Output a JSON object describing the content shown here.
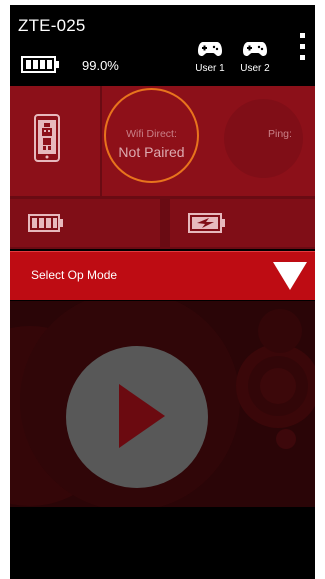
{
  "header": {
    "device_name": "ZTE-025",
    "battery_percent": "99.0%",
    "users": [
      {
        "label": "User 1",
        "icon": "gamepad-icon"
      },
      {
        "label": "User 2",
        "icon": "gamepad-icon"
      }
    ],
    "menu_icon": "overflow-menu-icon"
  },
  "status": {
    "robot_icon": "robot-controller-icon",
    "wifi_title": "Wifi Direct:",
    "wifi_state": "Not Paired",
    "ping_label": "Ping:",
    "robot_battery_icon": "robot-battery-icon",
    "controller_battery_icon": "charging-battery-icon"
  },
  "opmode": {
    "label": "Select Op Mode",
    "icon": "dropdown-triangle-icon"
  },
  "play": {
    "icon": "play-icon"
  },
  "colors": {
    "panel_red": "#8c1019",
    "opmode_red": "#be0c13",
    "wifi_ring": "#e8741d",
    "play_button": "#585858",
    "play_triangle": "#6b0a10"
  }
}
